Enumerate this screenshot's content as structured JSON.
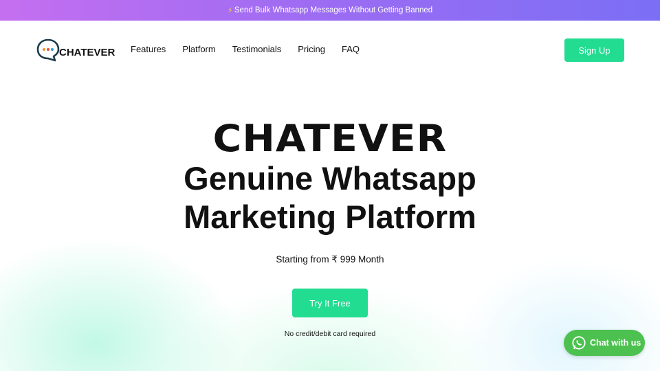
{
  "announcement": {
    "icon": "lightning-icon",
    "text": "Send Bulk Whatsapp Messages Without Getting Banned"
  },
  "header": {
    "logo_text": "CHATEVER",
    "logo_icon": "chat-bubble-icon",
    "nav": [
      "Features",
      "Platform",
      "Testimonials",
      "Pricing",
      "FAQ"
    ],
    "signup_label": "Sign Up"
  },
  "hero": {
    "brand": "CHATEVER",
    "title_line1": "Genuine Whatsapp",
    "title_line2": "Marketing Platform",
    "price_text": "Starting from ₹ 999 Month",
    "cta_label": "Try It Free",
    "note": "No credit/debit card required"
  },
  "chat_widget": {
    "icon": "whatsapp-icon",
    "label": "Chat with us"
  },
  "colors": {
    "accent": "#22dc91",
    "banner_start": "#c46ff0",
    "banner_end": "#7b6ff5",
    "whatsapp": "#4cc14f"
  }
}
